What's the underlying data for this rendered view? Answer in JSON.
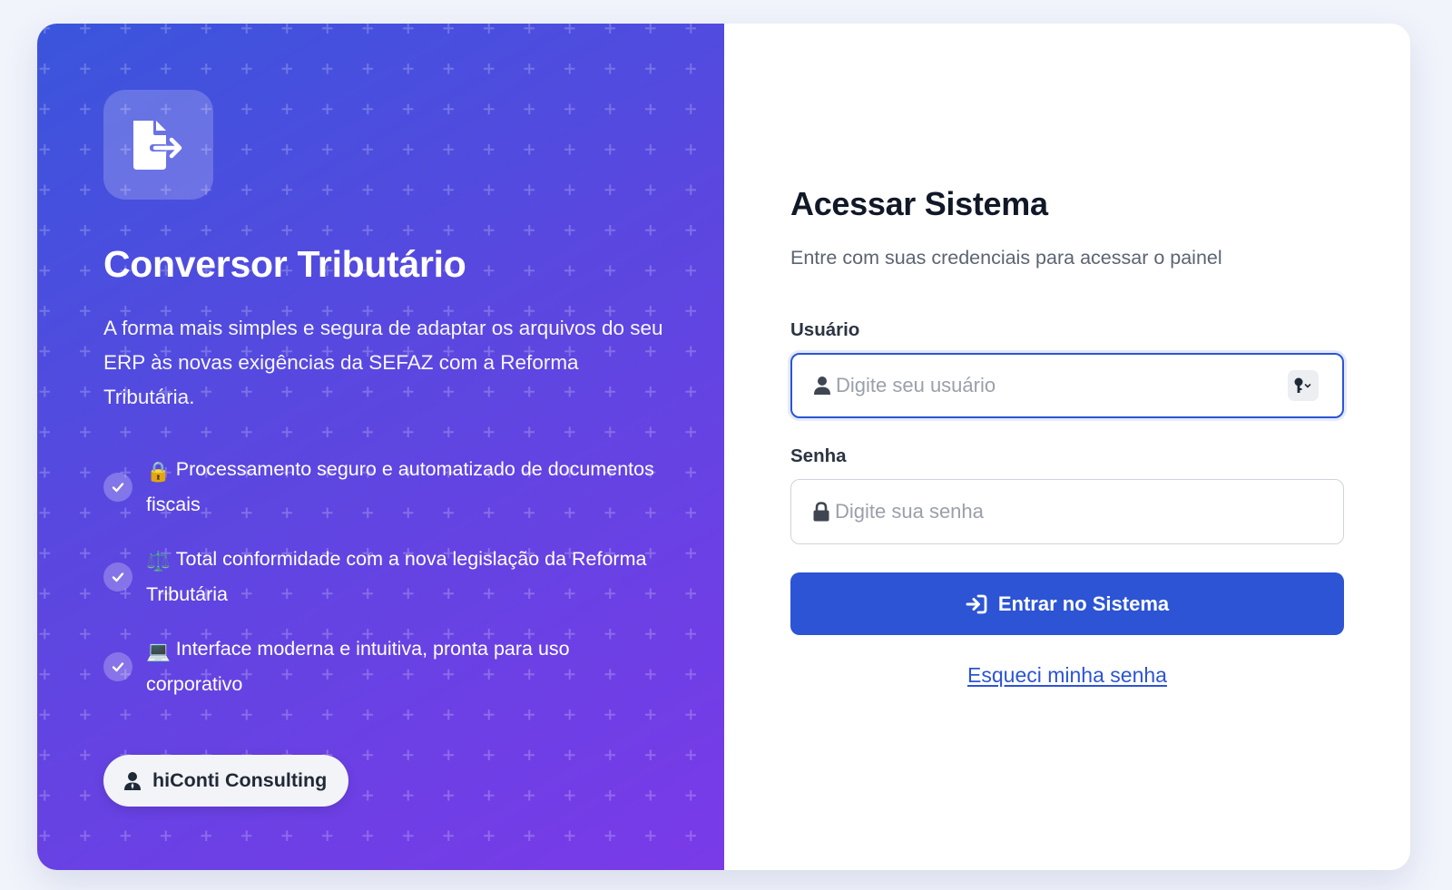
{
  "brand": {
    "logo_icon": "file-export-icon",
    "title": "Conversor Tributário",
    "description": "A forma mais simples e segura de adaptar os arquivos do seu ERP às novas exigências da SEFAZ com a Reforma Tributária.",
    "features": [
      {
        "emoji": "🔒",
        "text": "Processamento seguro e automatizado de documentos fiscais"
      },
      {
        "emoji": "⚖️",
        "text": "Total conformidade com a nova legislação da Reforma Tributária"
      },
      {
        "emoji": "💻",
        "text": "Interface moderna e intuitiva, pronta para uso corporativo"
      }
    ],
    "company_badge": "hiConti Consulting"
  },
  "login": {
    "title": "Acessar Sistema",
    "subtitle": "Entre com suas credenciais para acessar o painel",
    "username_label": "Usuário",
    "username_placeholder": "Digite seu usuário",
    "username_value": "",
    "password_label": "Senha",
    "password_placeholder": "Digite sua senha",
    "password_value": "",
    "submit_label": "Entrar no Sistema",
    "forgot_label": "Esqueci minha senha"
  },
  "colors": {
    "gradient_start": "#3a55dc",
    "gradient_end": "#7a3ae8",
    "primary": "#2c54d4",
    "page_bg": "#f1f4fb"
  }
}
